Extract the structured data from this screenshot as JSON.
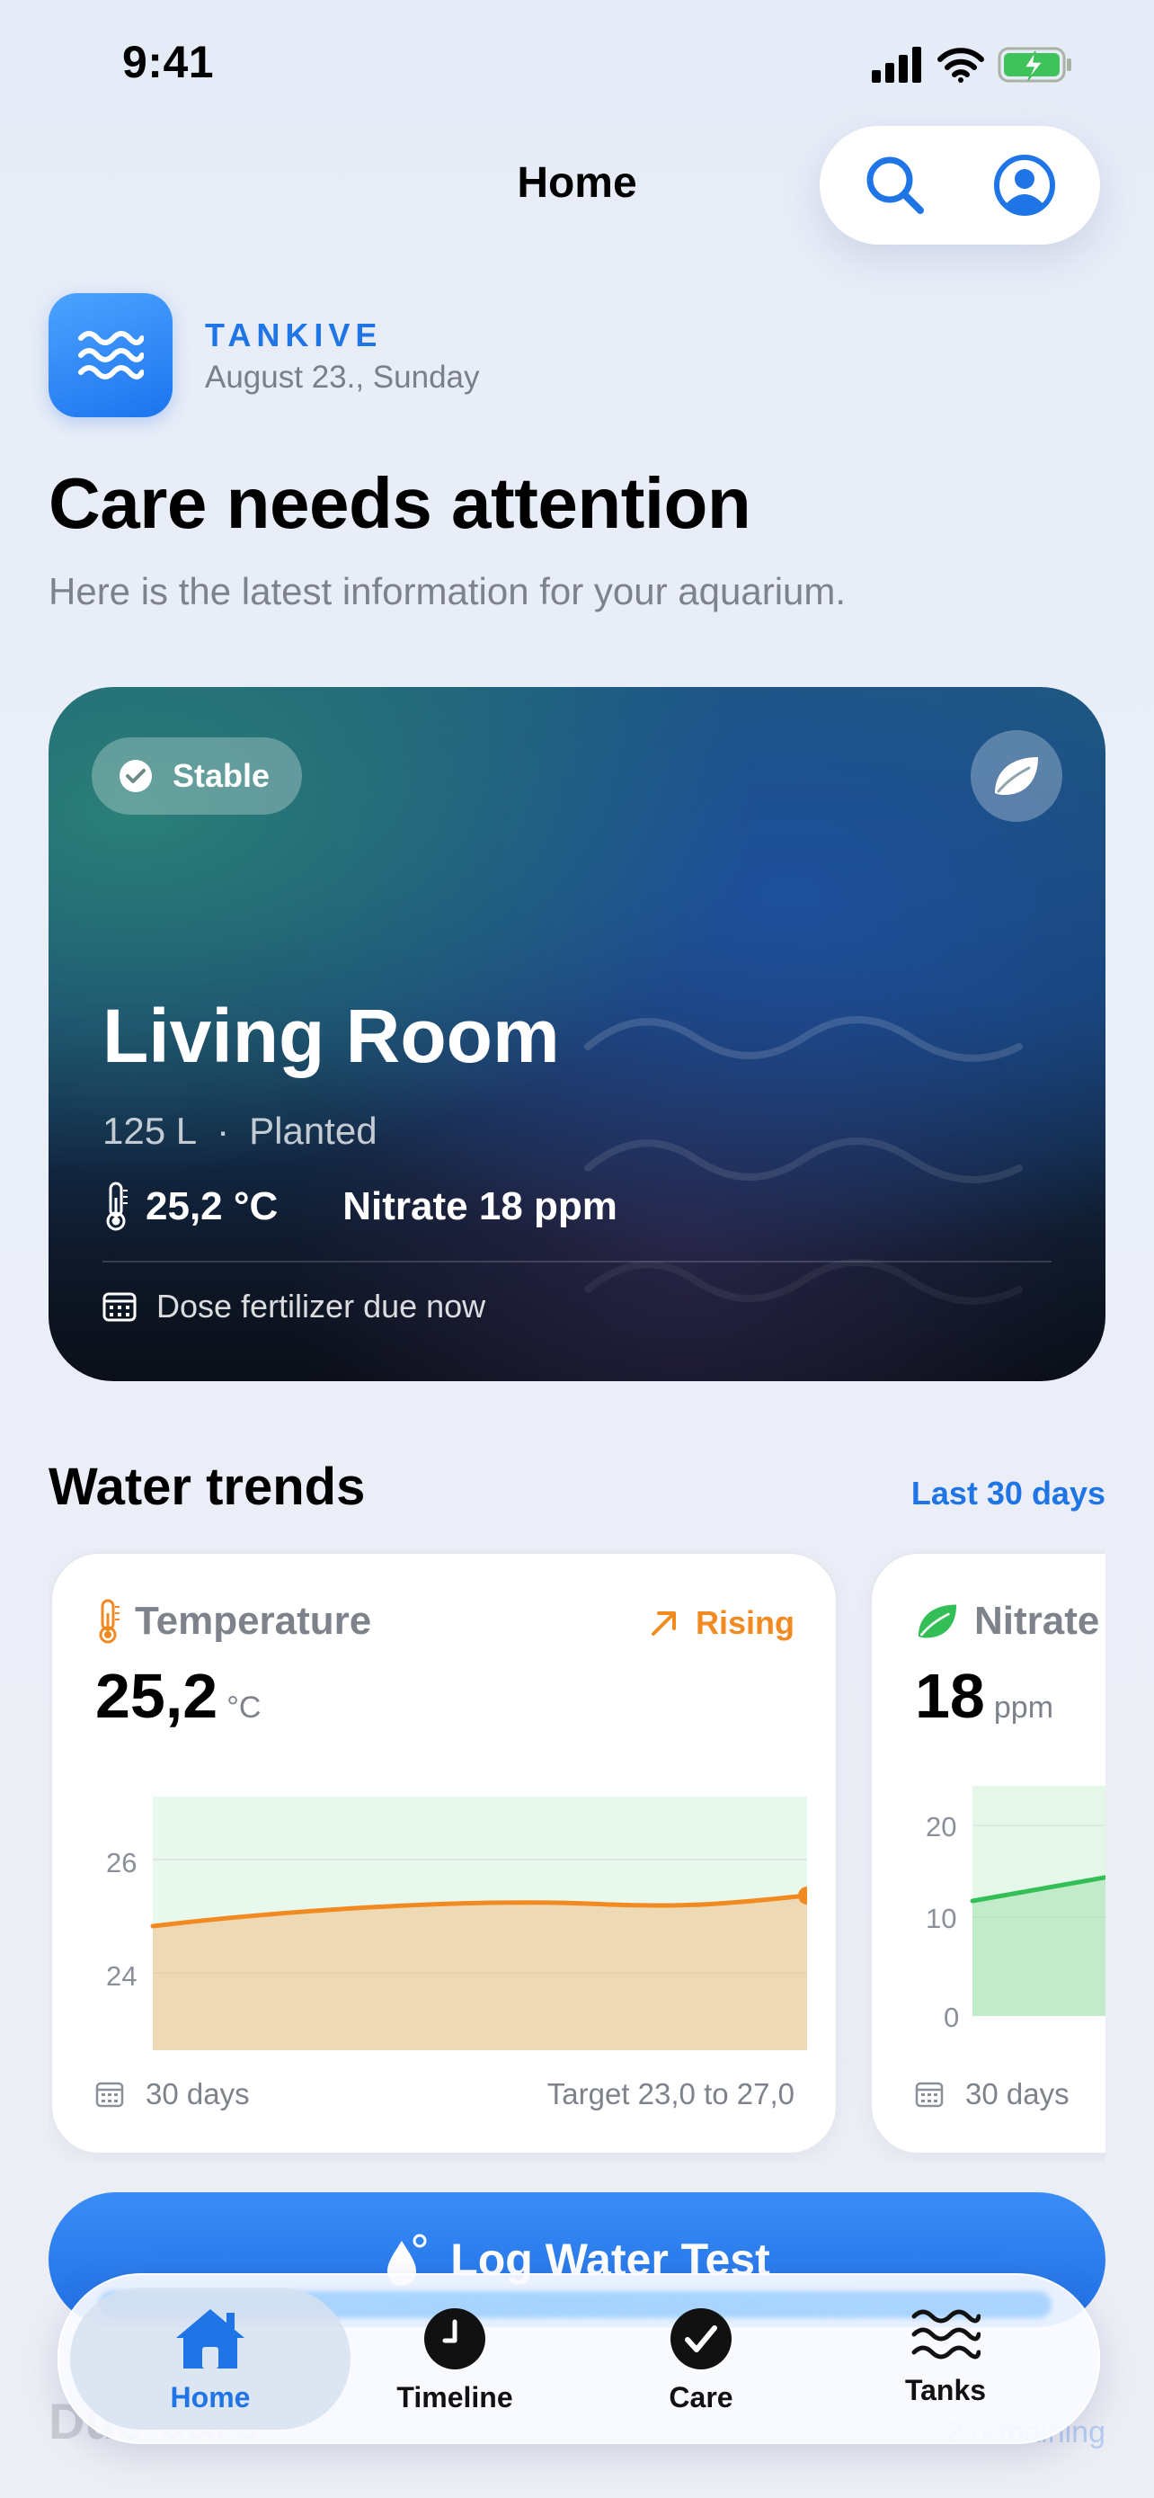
{
  "status_bar": {
    "time": "9:41"
  },
  "nav": {
    "title": "Home"
  },
  "brand": {
    "name": "TANKIVE",
    "date": "August 23., Sunday"
  },
  "headline": "Care needs attention",
  "subhead": "Here is the latest information for your aquarium.",
  "hero": {
    "status": "Stable",
    "name": "Living Room",
    "volume": "125 L",
    "separator": "·",
    "type": "Planted",
    "temperature": "25,2 °C",
    "nitrate": "Nitrate 18 ppm",
    "due": "Dose fertilizer due now"
  },
  "trends": {
    "title": "Water trends",
    "range_link": "Last 30 days",
    "cards": [
      {
        "label": "Temperature",
        "trend": "Rising",
        "value": "25,2",
        "unit": "°C",
        "period": "30 days",
        "target": "Target 23,0 to 27,0",
        "y_ticks": [
          "26",
          "24"
        ],
        "accent": "#f28a22"
      },
      {
        "label": "Nitrate",
        "value": "18",
        "unit": "ppm",
        "period": "30 days",
        "y_ticks": [
          "20",
          "10",
          "0"
        ],
        "accent": "#33bf56"
      }
    ]
  },
  "actions": {
    "log_label": "Log Water Test"
  },
  "due_section": {
    "title": "Due care",
    "right": "2 remaining"
  },
  "tabs": [
    {
      "label": "Home",
      "icon": "house-icon",
      "active": true
    },
    {
      "label": "Timeline",
      "icon": "clock-icon",
      "active": false
    },
    {
      "label": "Care",
      "icon": "checkmark-circle-icon",
      "active": false
    },
    {
      "label": "Tanks",
      "icon": "waves-icon",
      "active": false
    }
  ],
  "colors": {
    "accent": "#1f74e6",
    "warning": "#f28a22",
    "success": "#33bf56"
  }
}
